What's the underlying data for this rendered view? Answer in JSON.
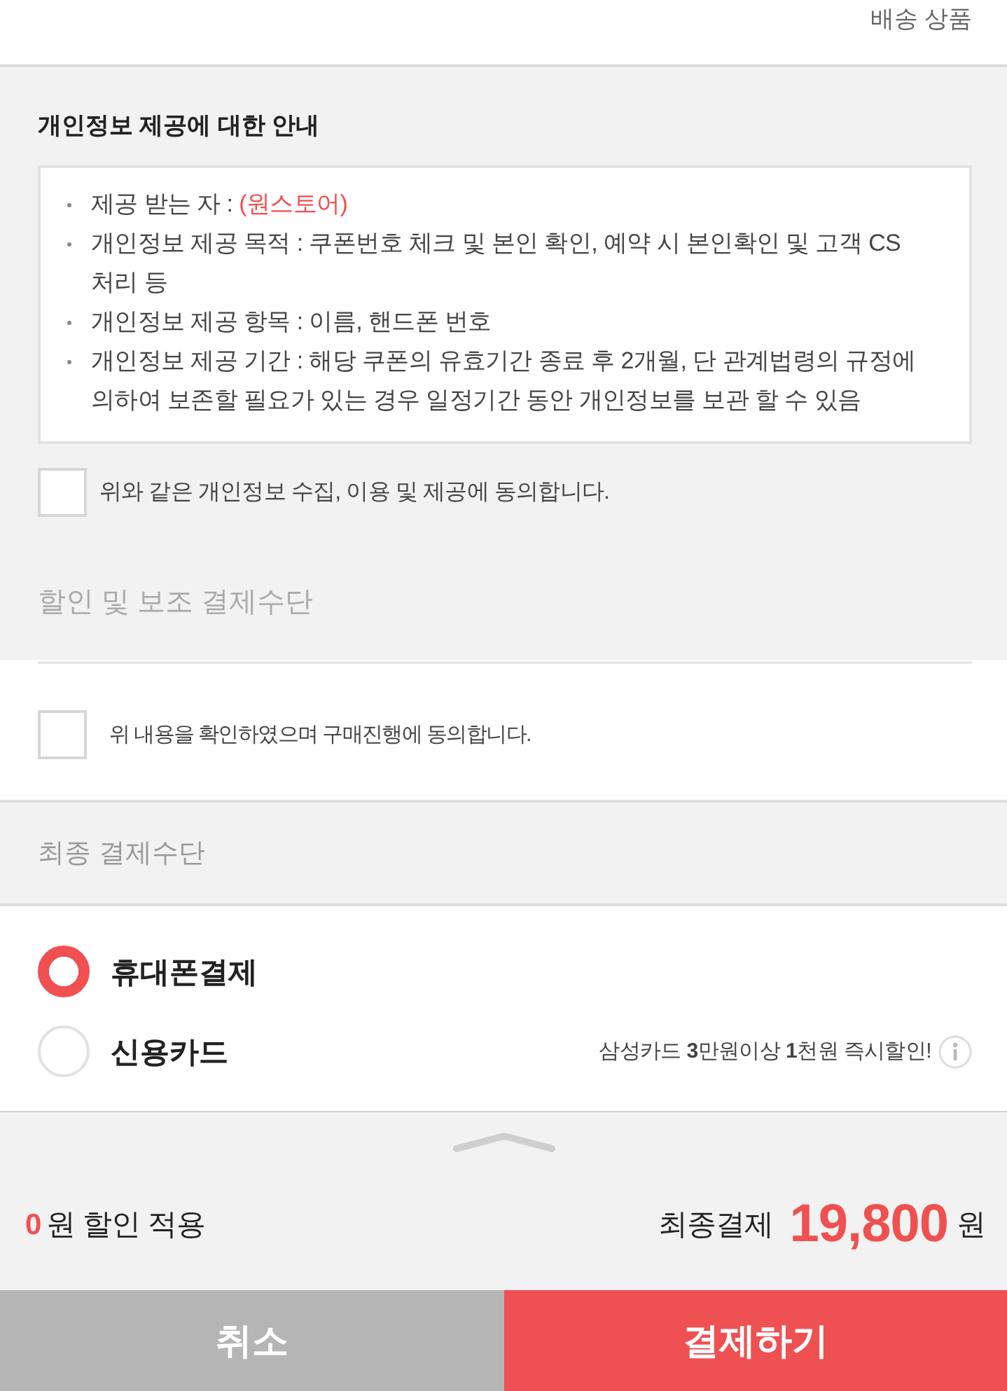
{
  "header": {
    "label": "배송 상품"
  },
  "privacy_notice": {
    "title": "개인정보 제공에 대한 안내",
    "items": [
      {
        "text": "제공 받는 자 :",
        "highlight": "(원스토어)"
      },
      {
        "text": "개인정보 제공 목적 : 쿠폰번호 체크 및 본인 확인, 예약 시 본인확인 및 고객 CS 처리 등"
      },
      {
        "text": "개인정보 제공 항목 : 이름, 핸드폰 번호"
      },
      {
        "text": "개인정보 제공 기간 : 해당 쿠폰의 유효기간 종료 후 2개월, 단 관계법령의 규정에 의하여 보존할 필요가 있는 경우 일정기간 동안 개인정보를 보관 할 수 있음"
      }
    ],
    "consent": {
      "label": "위와 같은 개인정보 수집, 이용 및 제공에 동의합니다.",
      "checked": false
    }
  },
  "discount_section": {
    "title": "할인 및 보조 결제수단",
    "consent": {
      "label": "위 내용을 확인하였으며 구매진행에 동의합니다.",
      "checked": false
    }
  },
  "payment_section": {
    "title": "최종 결제수단",
    "options": [
      {
        "label": "휴대폰결제",
        "selected": true
      },
      {
        "label": "신용카드",
        "selected": false,
        "promo": "삼성카드 **3**만원이상 **1**천원 즉시할인!"
      }
    ]
  },
  "summary": {
    "discount_amount": "0",
    "discount_label": "원 할인 적용",
    "total_label": "최종결제",
    "total_amount": "19,800",
    "currency": "원"
  },
  "buttons": [
    {
      "label": "취소",
      "kind": "cancel"
    },
    {
      "label": "결제하기",
      "kind": "primary"
    }
  ]
}
